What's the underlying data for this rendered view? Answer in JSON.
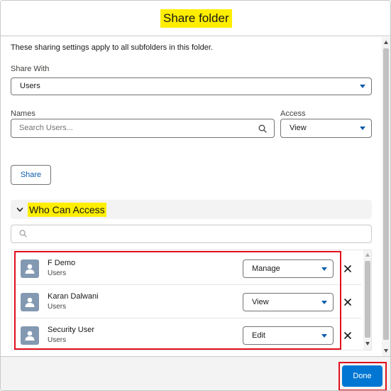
{
  "modal": {
    "title": "Share folder"
  },
  "form": {
    "help_text": "These sharing settings apply to all subfolders in this folder.",
    "share_with": {
      "label": "Share With",
      "value": "Users"
    },
    "names": {
      "label": "Names",
      "placeholder": "Search Users..."
    },
    "access": {
      "label": "Access",
      "value": "View"
    },
    "share_button": "Share"
  },
  "who_can_access": {
    "title": "Who Can Access",
    "filter_placeholder": "",
    "rows": [
      {
        "name": "F Demo",
        "type": "Users",
        "access": "Manage"
      },
      {
        "name": "Karan Dalwani",
        "type": "Users",
        "access": "View"
      },
      {
        "name": "Security User",
        "type": "Users",
        "access": "Edit"
      }
    ]
  },
  "footer": {
    "done_label": "Done"
  },
  "icons": {
    "search": "search-icon",
    "chevron": "chevron-down-icon",
    "user": "user-icon",
    "remove": "close-icon"
  },
  "colors": {
    "brand": "#0176d3",
    "highlight": "#ffee00",
    "annotation": "#e0101d",
    "avatar": "#8399b1"
  }
}
